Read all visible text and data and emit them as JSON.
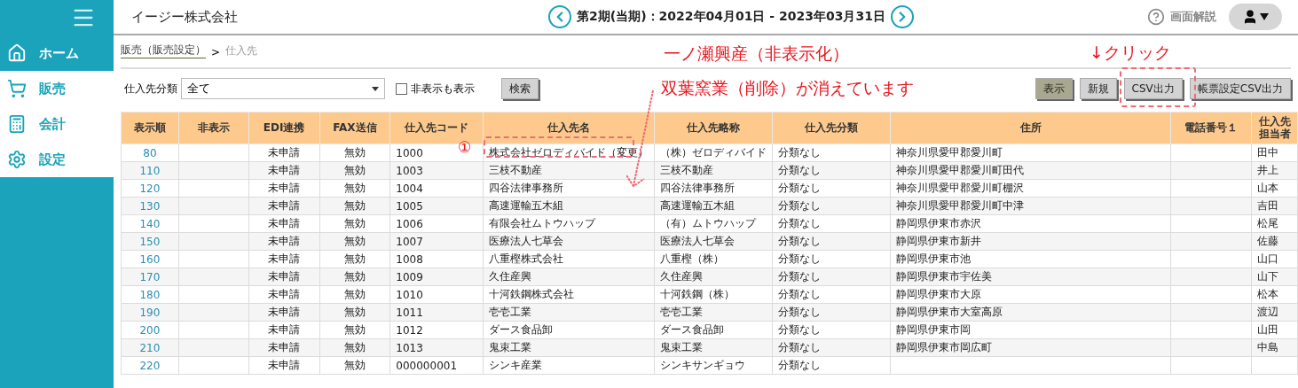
{
  "company": "イージー株式会社",
  "period": "第2期(当期)：2022年04月01日 - 2023年03月31日",
  "help": "画面解説",
  "sidebar": {
    "items": [
      {
        "label": "ホーム",
        "selected": true
      },
      {
        "label": "販売",
        "selected": false
      },
      {
        "label": "会計",
        "selected": false
      },
      {
        "label": "設定",
        "selected": false
      }
    ]
  },
  "breadcrumb": {
    "link": "販売（販売設定）",
    "separator": ">",
    "current": "仕入先"
  },
  "filter": {
    "label": "仕入先分類",
    "value": "全て",
    "checkbox_label": "非表示も表示",
    "checked": false,
    "search": "検索"
  },
  "buttons": [
    {
      "label": "表示",
      "kind": "dark"
    },
    {
      "label": "新規",
      "kind": "normal"
    },
    {
      "label": "CSV出力",
      "kind": "normal"
    },
    {
      "label": "帳票設定CSV出力",
      "kind": "normal"
    }
  ],
  "annotations": [
    {
      "kind": "note",
      "text": "一ノ瀬興産（非表示化）"
    },
    {
      "kind": "note",
      "text": "双葉窯業（削除）が消えています"
    },
    {
      "kind": "note",
      "text": "↓クリック"
    },
    {
      "kind": "marker",
      "text": "①"
    }
  ],
  "table": {
    "columns": [
      "表示順",
      "非表示",
      "EDI連携",
      "FAX送信",
      "仕入先コード",
      "仕入先名",
      "仕入先略称",
      "仕入先分類",
      "住所",
      "電話番号１",
      "仕入先担当者"
    ],
    "rows": [
      {
        "order": "80",
        "edi": "未申請",
        "fax": "無効",
        "code": "1000",
        "name": "株式会社ゼロディバイド（変更）",
        "short": "（株）ゼロディバイド",
        "category": "分類なし",
        "address": "神奈川県愛甲郡愛川町",
        "person": "田中"
      },
      {
        "order": "110",
        "edi": "未申請",
        "fax": "無効",
        "code": "1003",
        "name": "三枝不動産",
        "short": "三枝不動産",
        "category": "分類なし",
        "address": "神奈川県愛甲郡愛川町田代",
        "person": "井上"
      },
      {
        "order": "120",
        "edi": "未申請",
        "fax": "無効",
        "code": "1004",
        "name": "四谷法律事務所",
        "short": "四谷法律事務所",
        "category": "分類なし",
        "address": "神奈川県愛甲郡愛川町棚沢",
        "person": "山本"
      },
      {
        "order": "130",
        "edi": "未申請",
        "fax": "無効",
        "code": "1005",
        "name": "高速運輸五木組",
        "short": "高速運輸五木組",
        "category": "分類なし",
        "address": "神奈川県愛甲郡愛川町中津",
        "person": "吉田"
      },
      {
        "order": "140",
        "edi": "未申請",
        "fax": "無効",
        "code": "1006",
        "name": "有限会社ムトウハップ",
        "short": "（有）ムトウハップ",
        "category": "分類なし",
        "address": "静岡県伊東市赤沢",
        "person": "松尾"
      },
      {
        "order": "150",
        "edi": "未申請",
        "fax": "無効",
        "code": "1007",
        "name": "医療法人七草会",
        "short": "医療法人七草会",
        "category": "分類なし",
        "address": "静岡県伊東市新井",
        "person": "佐藤"
      },
      {
        "order": "160",
        "edi": "未申請",
        "fax": "無効",
        "code": "1008",
        "name": "八重樫株式会社",
        "short": "八重樫（株）",
        "category": "分類なし",
        "address": "静岡県伊東市池",
        "person": "山口"
      },
      {
        "order": "170",
        "edi": "未申請",
        "fax": "無効",
        "code": "1009",
        "name": "久住産興",
        "short": "久住産興",
        "category": "分類なし",
        "address": "静岡県伊東市宇佐美",
        "person": "山下"
      },
      {
        "order": "180",
        "edi": "未申請",
        "fax": "無効",
        "code": "1010",
        "name": "十河鉄鋼株式会社",
        "short": "十河鉄鋼（株）",
        "category": "分類なし",
        "address": "静岡県伊東市大原",
        "person": "松本"
      },
      {
        "order": "190",
        "edi": "未申請",
        "fax": "無効",
        "code": "1011",
        "name": "壱壱工業",
        "short": "壱壱工業",
        "category": "分類なし",
        "address": "静岡県伊東市大室高原",
        "person": "渡辺"
      },
      {
        "order": "200",
        "edi": "未申請",
        "fax": "無効",
        "code": "1012",
        "name": "ダース食品卸",
        "short": "ダース食品卸",
        "category": "分類なし",
        "address": "静岡県伊東市岡",
        "person": "山田"
      },
      {
        "order": "210",
        "edi": "未申請",
        "fax": "無効",
        "code": "1013",
        "name": "鬼束工業",
        "short": "鬼束工業",
        "category": "分類なし",
        "address": "静岡県伊東市岡広町",
        "person": "中島"
      },
      {
        "order": "220",
        "edi": "未申請",
        "fax": "無効",
        "code": "000000001",
        "name": "シンキ産業",
        "short": "シンキサンギョウ",
        "category": "分類なし"
      }
    ]
  }
}
